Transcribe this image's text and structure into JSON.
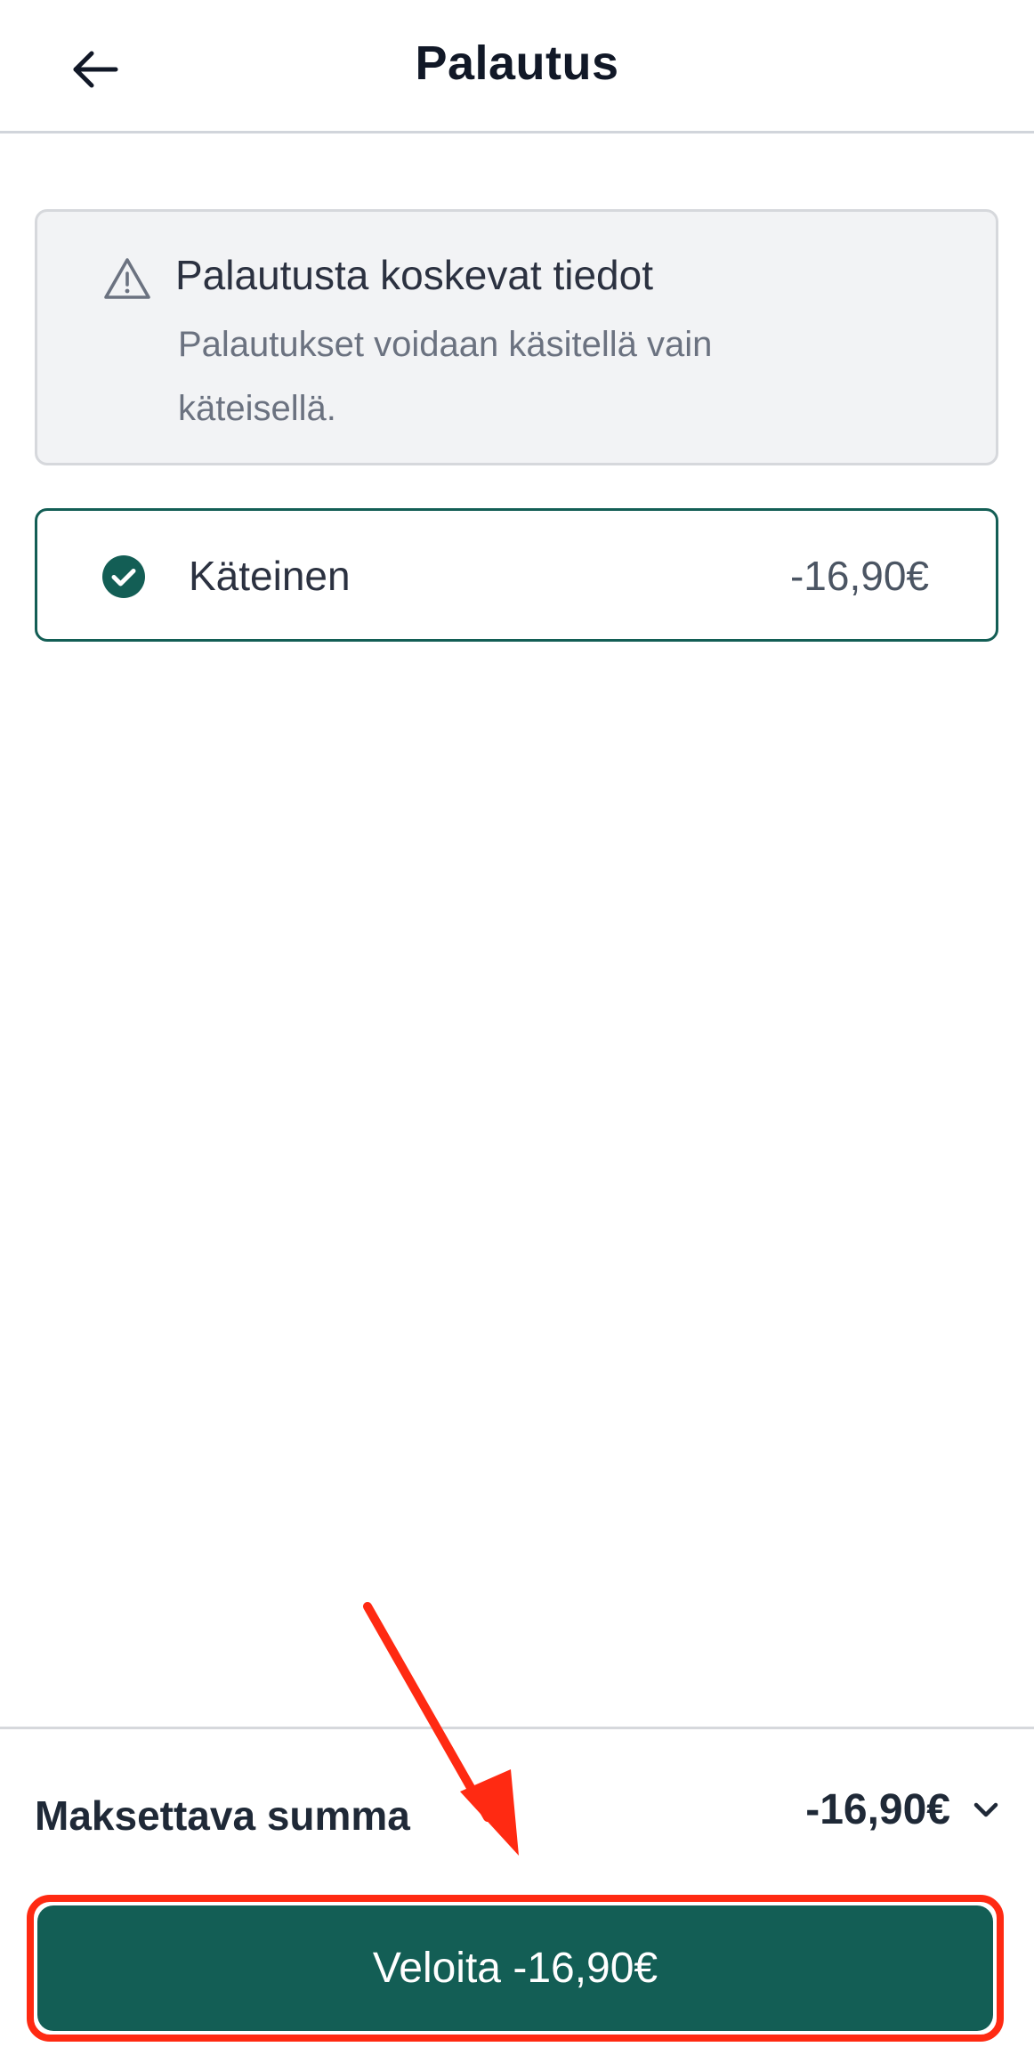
{
  "header": {
    "title": "Palautus",
    "back_icon": "arrow-left-icon"
  },
  "info": {
    "icon": "warning-triangle-icon",
    "title": "Palautusta koskevat tiedot",
    "text": "Palautukset voidaan käsitellä vain käteisellä."
  },
  "payment_option": {
    "icon": "check-circle-icon",
    "label": "Käteinen",
    "amount": "-16,90€",
    "selected": true
  },
  "summary": {
    "label": "Maksettava summa",
    "amount": "-16,90€",
    "expand_icon": "chevron-down-icon"
  },
  "charge_button": {
    "label": "Veloita -16,90€"
  },
  "colors": {
    "brand": "#135e55",
    "annotation": "#ff2a12"
  }
}
